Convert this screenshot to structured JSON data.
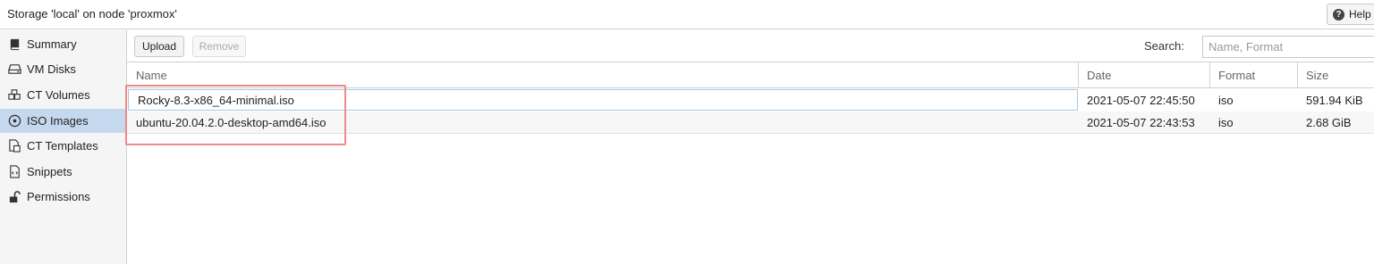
{
  "window": {
    "title": "Storage 'local' on node 'proxmox'",
    "help_label": "Help"
  },
  "sidebar": {
    "items": [
      {
        "label": "Summary",
        "icon": "book-icon"
      },
      {
        "label": "VM Disks",
        "icon": "hdd-icon"
      },
      {
        "label": "CT Volumes",
        "icon": "cubes-icon"
      },
      {
        "label": "ISO Images",
        "icon": "disc-icon"
      },
      {
        "label": "CT Templates",
        "icon": "file-cube-icon"
      },
      {
        "label": "Snippets",
        "icon": "code-file-icon"
      },
      {
        "label": "Permissions",
        "icon": "unlock-icon"
      }
    ],
    "active": "ISO Images"
  },
  "toolbar": {
    "upload_label": "Upload",
    "remove_label": "Remove",
    "search_label": "Search:",
    "search_placeholder": "Name, Format",
    "search_value": ""
  },
  "table": {
    "columns": [
      "Name",
      "Date",
      "Format",
      "Size"
    ],
    "rows": [
      {
        "name": "Rocky-8.3-x86_64-minimal.iso",
        "date": "2021-05-07 22:45:50",
        "format": "iso",
        "size": "591.94 KiB"
      },
      {
        "name": "ubuntu-20.04.2.0-desktop-amd64.iso",
        "date": "2021-05-07 22:43:53",
        "format": "iso",
        "size": "2.68 GiB"
      }
    ]
  },
  "colors": {
    "active_sidebar": "#c5d9ee",
    "highlight_annotation": "#ef8a8a",
    "selected_cell_border": "#a9c6e3"
  }
}
